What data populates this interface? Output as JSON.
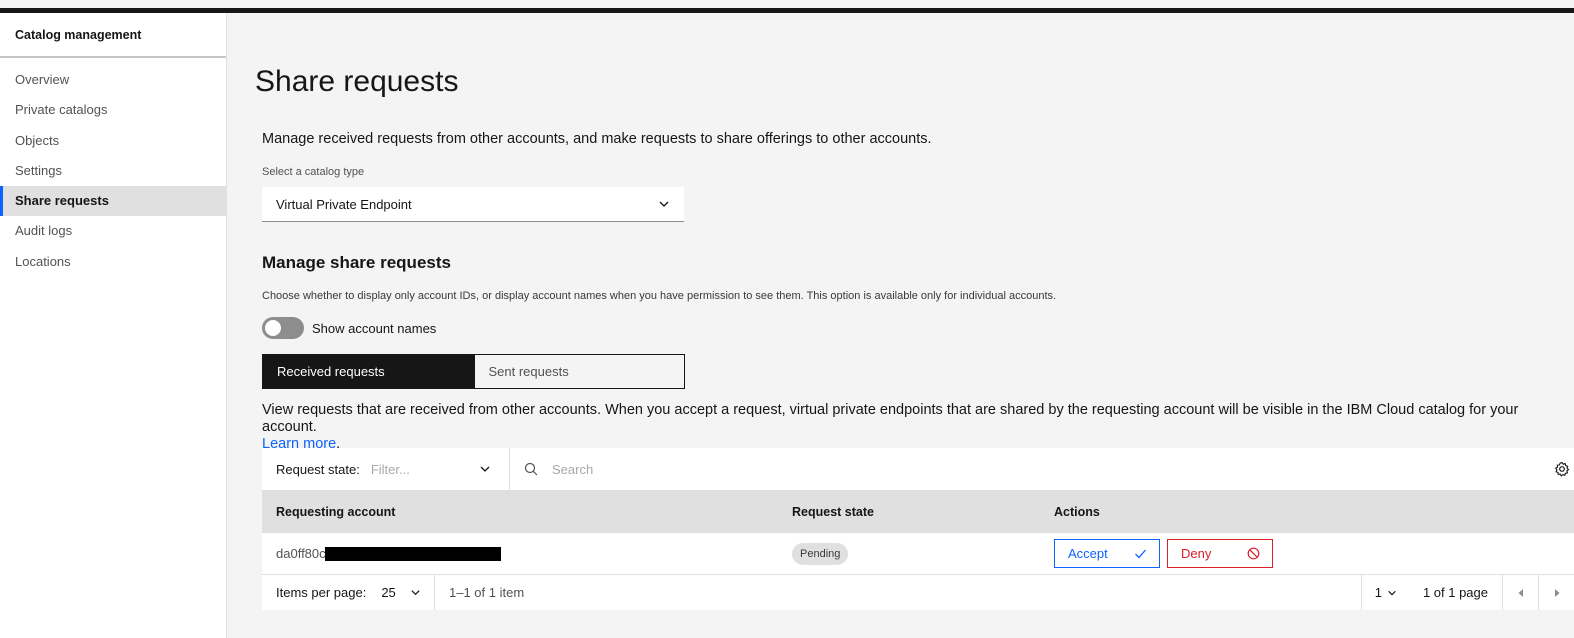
{
  "sidebar": {
    "title": "Catalog management",
    "items": [
      {
        "label": "Overview"
      },
      {
        "label": "Private catalogs"
      },
      {
        "label": "Objects"
      },
      {
        "label": "Settings"
      },
      {
        "label": "Share requests"
      },
      {
        "label": "Audit logs"
      },
      {
        "label": "Locations"
      }
    ],
    "active_item": "Share requests"
  },
  "page": {
    "title": "Share requests",
    "intro": "Manage received requests from other accounts, and make requests to share offerings to other accounts.",
    "catalog_select": {
      "label": "Select a catalog type",
      "value": "Virtual Private Endpoint"
    },
    "manage": {
      "title": "Manage share requests",
      "description": "Choose whether to display only account IDs, or display account names when you have permission to see them. This option is available only for individual accounts.",
      "toggle_label": "Show account names",
      "toggle_on": false
    },
    "switcher": {
      "received": "Received requests",
      "sent": "Sent requests",
      "selected": "received"
    },
    "view_desc": {
      "text": "View requests that are received from other accounts. When you accept a request, virtual private endpoints that are shared by the requesting account will be visible in the IBM Cloud catalog for your account.",
      "link": "Learn more",
      "suffix": "."
    }
  },
  "table": {
    "filter": {
      "label": "Request state:",
      "placeholder": "Filter..."
    },
    "search": {
      "placeholder": "Search"
    },
    "headers": {
      "account": "Requesting account",
      "state": "Request state",
      "actions": "Actions"
    },
    "rows": [
      {
        "account": "da0ff80c",
        "state": "Pending",
        "accept": "Accept",
        "deny": "Deny"
      }
    ],
    "pagination": {
      "items_per_page_label": "Items per page:",
      "items_per_page": "25",
      "range": "1–1 of 1 item",
      "page": "1",
      "page_of": "1 of 1 page"
    }
  },
  "colors": {
    "accent": "#0f62fe",
    "danger": "#da1e28",
    "dark": "#161616"
  }
}
